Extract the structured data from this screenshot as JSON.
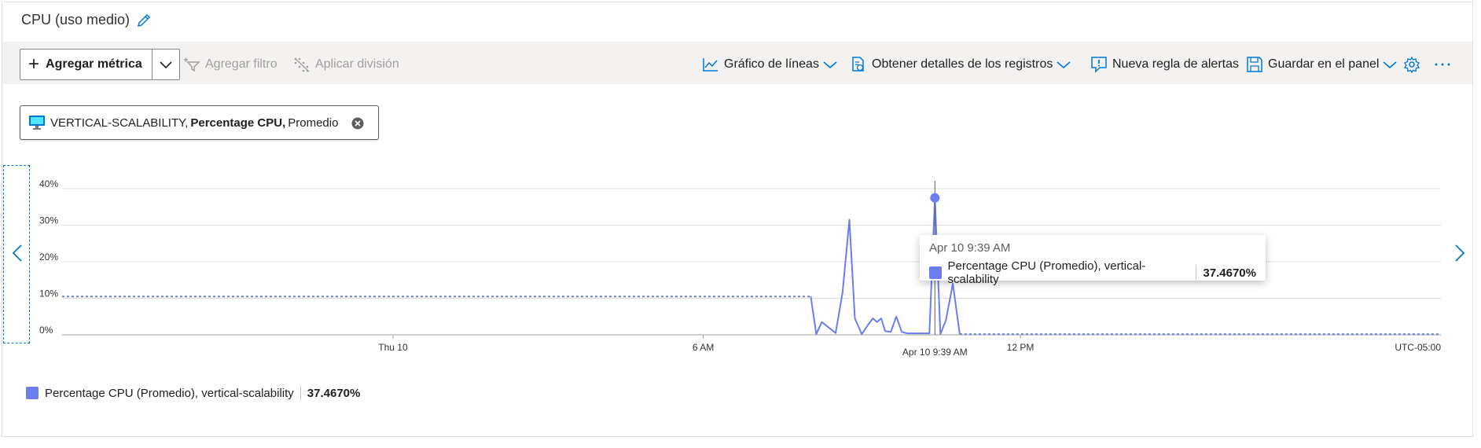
{
  "header": {
    "title": "CPU (uso medio)"
  },
  "toolbar": {
    "add_metric": "Agregar métrica",
    "add_filter": "Agregar filtro",
    "apply_split": "Aplicar división",
    "line_chart": "Gráfico de líneas",
    "logs": "Obtener detalles de los registros",
    "alert_rule": "Nueva regla de alertas",
    "save_dashboard": "Guardar en el panel"
  },
  "metric_pill": {
    "resource": "VERTICAL-SCALABILITY,",
    "metric": "Percentage CPU,",
    "aggregation": "Promedio"
  },
  "tooltip": {
    "time": "Apr 10 9:39 AM",
    "series": "Percentage CPU (Promedio), vertical-scalability",
    "value": "37.4670%"
  },
  "legend": {
    "series": "Percentage CPU (Promedio), vertical-scalability",
    "value": "37.4670%"
  },
  "colors": {
    "series": "#6a7ef0",
    "accent": "#0078d4"
  },
  "chart_data": {
    "type": "line",
    "y_ticks": [
      "0%",
      "10%",
      "20%",
      "30%",
      "40%"
    ],
    "ylim": [
      0,
      40
    ],
    "x_ticks": [
      "Thu 10",
      "6 AM",
      "12 PM"
    ],
    "x_hover_label": "Apr 10 9:39 AM",
    "timezone": "UTC-05:00",
    "grid": true,
    "series": [
      {
        "values_dashed_start": [
          [
            0,
            10.5
          ],
          [
            0.543,
            10.5
          ]
        ],
        "values": [
          [
            0.543,
            10.5
          ],
          [
            0.547,
            0.2
          ],
          [
            0.551,
            3.5
          ],
          [
            0.556,
            2.0
          ],
          [
            0.561,
            0.5
          ],
          [
            0.566,
            11.5
          ],
          [
            0.571,
            31.5
          ],
          [
            0.575,
            4.5
          ],
          [
            0.58,
            0.2
          ],
          [
            0.585,
            3.0
          ],
          [
            0.588,
            4.5
          ],
          [
            0.591,
            3.5
          ],
          [
            0.594,
            4.5
          ],
          [
            0.597,
            1.0
          ],
          [
            0.601,
            0.8
          ],
          [
            0.605,
            5.0
          ],
          [
            0.609,
            0.8
          ],
          [
            0.613,
            0.4
          ],
          [
            0.617,
            0.4
          ],
          [
            0.621,
            0.4
          ],
          [
            0.625,
            0.4
          ],
          [
            0.629,
            0.4
          ],
          [
            0.633,
            37.467
          ],
          [
            0.637,
            0.2
          ],
          [
            0.641,
            4.0
          ],
          [
            0.646,
            14.0
          ],
          [
            0.651,
            0.2
          ]
        ],
        "values_dashed_end": [
          [
            0.651,
            0.2
          ],
          [
            1.0,
            0.2
          ]
        ]
      }
    ],
    "hover_point": {
      "x": 0.633,
      "y": 37.467
    }
  }
}
